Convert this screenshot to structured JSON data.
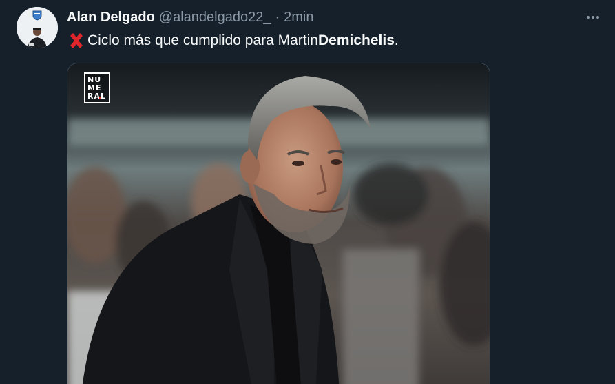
{
  "tweet": {
    "display_name": "Alan Delgado",
    "handle": "@alandelgado22_",
    "separator": "·",
    "time": "2min",
    "text_plain": "Ciclo más que cumplido para Martin ",
    "text_bold": "Demichelis",
    "text_end": ".",
    "emoji": "cross-mark"
  },
  "media": {
    "logo_lines": [
      "NU",
      "ME",
      "RAL"
    ],
    "subject": "man in black suit with grey hair and beard"
  },
  "icons": {
    "more": "more-horizontal-icon",
    "avatar": "user-avatar"
  },
  "colors": {
    "background": "#15202b",
    "primary_text": "#f7f9f9",
    "secondary_text": "#8b98a5",
    "border": "#38444d",
    "cross": "#e0262b"
  }
}
